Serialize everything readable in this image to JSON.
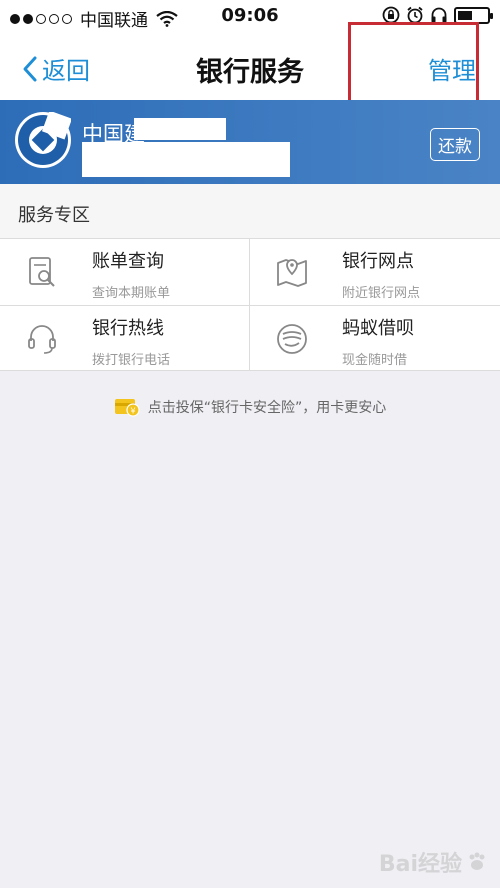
{
  "status_bar": {
    "carrier": "中国联通",
    "time": "09:06"
  },
  "nav": {
    "back_label": "返回",
    "title": "银行服务",
    "manage_label": "管理"
  },
  "card": {
    "bank_name_visible": "中国建",
    "repay_label": "还款"
  },
  "section": {
    "title": "服务专区"
  },
  "services": [
    {
      "title": "账单查询",
      "subtitle": "查询本期账单",
      "icon": "bill-search-icon"
    },
    {
      "title": "银行网点",
      "subtitle": "附近银行网点",
      "icon": "map-icon"
    },
    {
      "title": "银行热线",
      "subtitle": "拨打银行电话",
      "icon": "headset-icon"
    },
    {
      "title": "蚂蚁借呗",
      "subtitle": "现金随时借",
      "icon": "jiebei-icon"
    }
  ],
  "insurance": {
    "text": "点击投保“银行卡安全险”，用卡更安心"
  },
  "watermark": {
    "text": "Bai经验"
  },
  "colors": {
    "accent": "#1e8fd6",
    "card_blue": "#2d6db8",
    "highlight_red": "#c72c35"
  }
}
